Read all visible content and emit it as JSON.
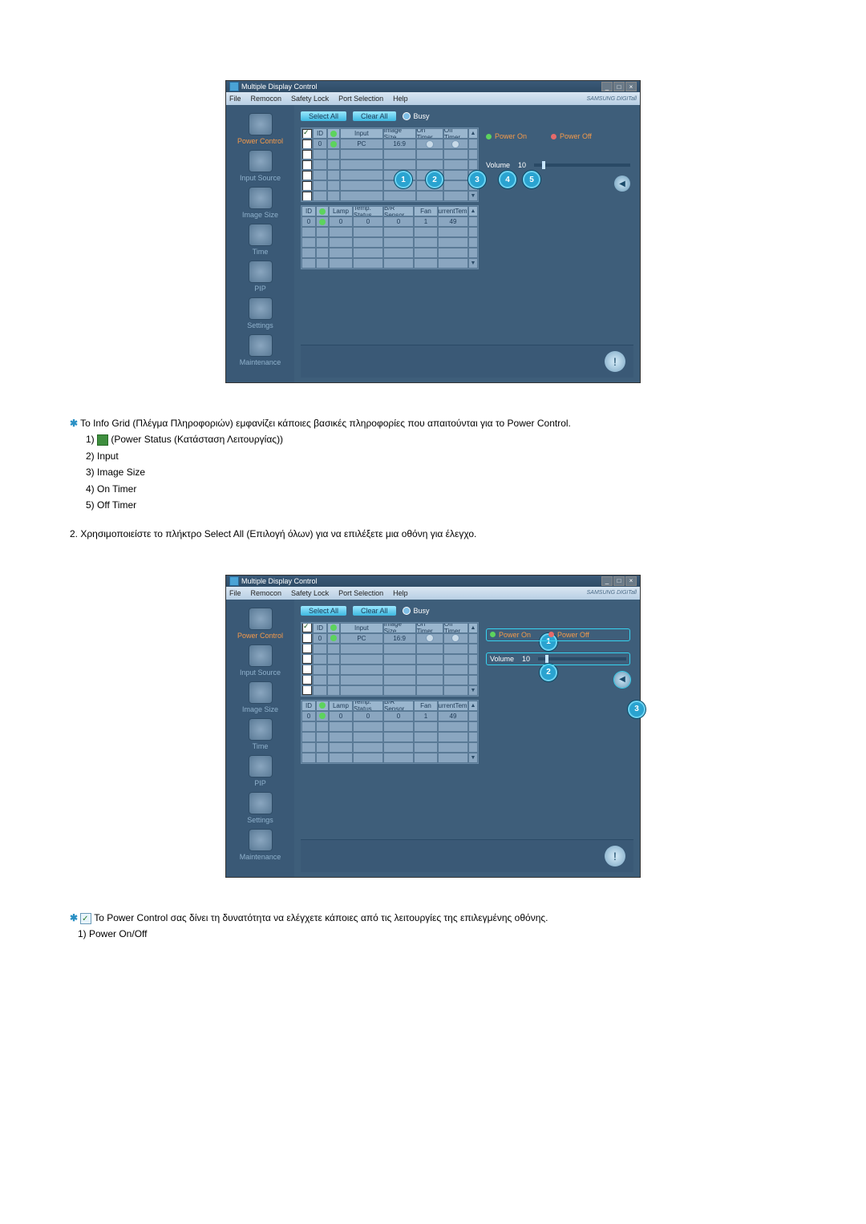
{
  "app": {
    "title": "Multiple Display Control",
    "menu": [
      "File",
      "Remocon",
      "Safety Lock",
      "Port Selection",
      "Help"
    ],
    "brand": "SAMSUNG DIGITall",
    "toolbar": {
      "select_all": "Select All",
      "clear_all": "Clear All",
      "busy": "Busy"
    },
    "sidebar": {
      "items": [
        "Power Control",
        "Input Source",
        "Image Size",
        "Time",
        "PIP",
        "Settings",
        "Maintenance"
      ]
    },
    "grid1": {
      "headers": {
        "id": "ID",
        "input": "Input",
        "image_size": "Image Size",
        "on_timer": "On Timer",
        "off_timer": "Off Timer"
      },
      "row": {
        "id": "0",
        "input": "PC",
        "image_size": "16:9"
      }
    },
    "grid2": {
      "headers": {
        "id": "ID",
        "lamp": "Lamp",
        "temp_status": "Temp. Status",
        "br_sensor": "B/R Sensor",
        "fan": "Fan",
        "current_temp": "CurrentTemp."
      },
      "row": {
        "id": "0",
        "lamp": "0",
        "temp_status": "0",
        "br_sensor": "0",
        "fan": "1",
        "current_temp": "49"
      }
    },
    "right": {
      "power_on": "Power On",
      "power_off": "Power Off",
      "volume_label": "Volume",
      "volume_value": "10"
    }
  },
  "text1": {
    "line0": "Το Info Grid (Πλέγμα Πληροφοριών) εμφανίζει κάποιες βασικές πληροφορίες που απαιτούνται για το Power Control.",
    "l1": "1) ",
    "l1b": " (Power Status (Κατάσταση Λειτουργίας))",
    "l2": "2) Input",
    "l3": "3) Image Size",
    "l4": "4) On Timer",
    "l5": "5) Off Timer",
    "line_after": "2.  Χρησιμοποιείστε το πλήκτρο Select All (Επιλογή όλων) για να επιλέξετε μια οθόνη για έλεγχο."
  },
  "text2": {
    "line": "Το Power Control σας δίνει τη δυνατότητα να ελέγχετε κάποιες από τις λειτουργίες της επιλεγμένης οθόνης.",
    "l1": "1)  Power On/Off"
  },
  "callouts_a": [
    "1",
    "2",
    "3",
    "4",
    "5"
  ],
  "callouts_b": [
    "1",
    "2",
    "3"
  ]
}
